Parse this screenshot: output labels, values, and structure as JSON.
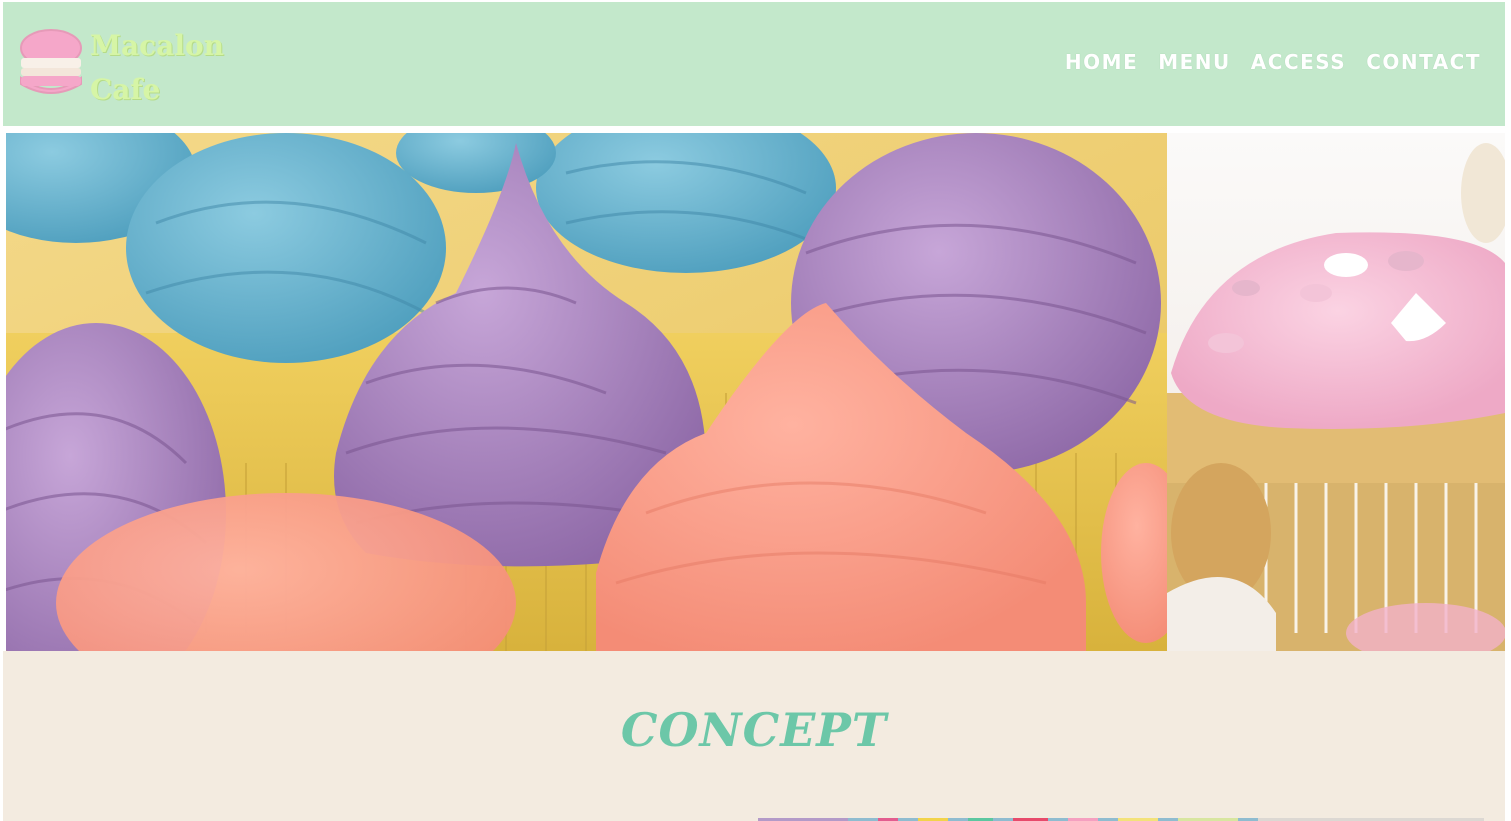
{
  "brand": {
    "name_line1": "Macalon",
    "name_line2": "Cafe",
    "logo_icon": "macaron-icon"
  },
  "nav": {
    "items": [
      {
        "label": "HOME"
      },
      {
        "label": "MENU"
      },
      {
        "label": "ACCESS"
      },
      {
        "label": "CONTACT"
      }
    ]
  },
  "hero": {
    "image_main": "cupcakes-pastel-frosting-photo",
    "image_side": "pink-iced-cupcake-photo"
  },
  "concept": {
    "title": "CONCEPT",
    "image": "sprinkles-cake-photo"
  },
  "colors": {
    "header_bg": "#c3e8cb",
    "logo_text": "#d6f5a6",
    "nav_text": "#ffffff",
    "concept_bg": "#f3ebe0",
    "concept_title": "#6cc7a8"
  }
}
